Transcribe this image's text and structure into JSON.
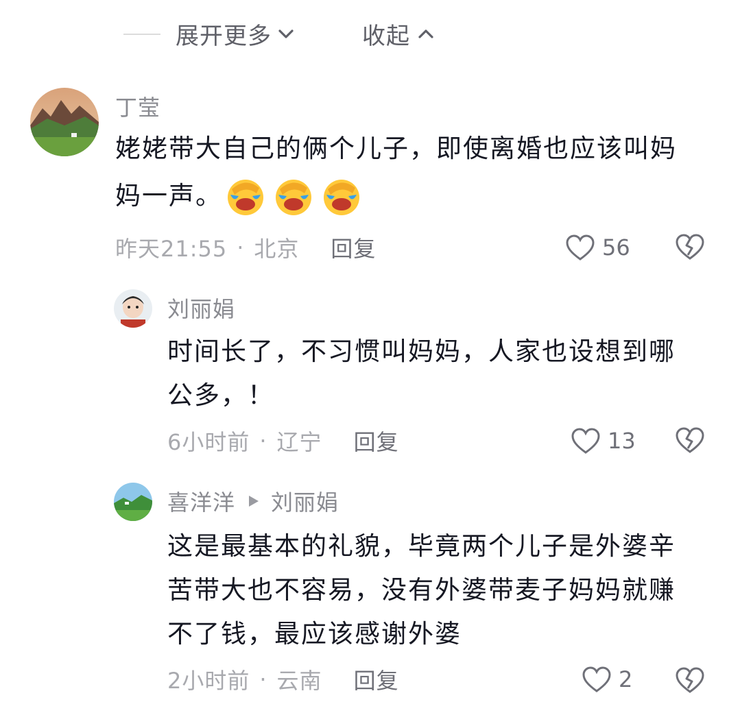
{
  "header": {
    "expand_label": "展开更多",
    "collapse_label": "收起"
  },
  "comments": [
    {
      "username": "丁莹",
      "text_line1": "姥姥带大自己的俩个儿子，即使离婚也应该叫妈",
      "text_line2": "妈一声。",
      "emoji_count": 3,
      "emoji_icon": "facepalm-crying-emoji",
      "time": "昨天21:55",
      "location": "北京",
      "reply_label": "回复",
      "likes": "56"
    },
    {
      "username": "刘丽娟",
      "text_line1": "时间长了，不习惯叫妈妈，人家也设想到哪",
      "text_line2": "公多，！",
      "time": "6小时前",
      "location": "辽宁",
      "reply_label": "回复",
      "likes": "13"
    },
    {
      "username": "喜洋洋",
      "reply_to": "刘丽娟",
      "text_line1": "这是最基本的礼貌，毕竟两个儿子是外婆辛",
      "text_line2": "苦带大也不容易，没有外婆带麦子妈妈就赚",
      "text_line3": "不了钱，最应该感谢外婆",
      "time": "2小时前",
      "location": "云南",
      "reply_label": "回复",
      "likes": "2"
    }
  ],
  "meta_separator": "·",
  "icons": {
    "like": "heart-outline-icon",
    "dislike": "broken-heart-icon",
    "expand": "chevron-down-icon",
    "collapse": "chevron-up-icon",
    "reply_arrow": "triangle-right-icon"
  },
  "colors": {
    "text_primary": "#161823",
    "text_secondary": "#8a8b91",
    "text_meta": "#a8a9ae"
  }
}
